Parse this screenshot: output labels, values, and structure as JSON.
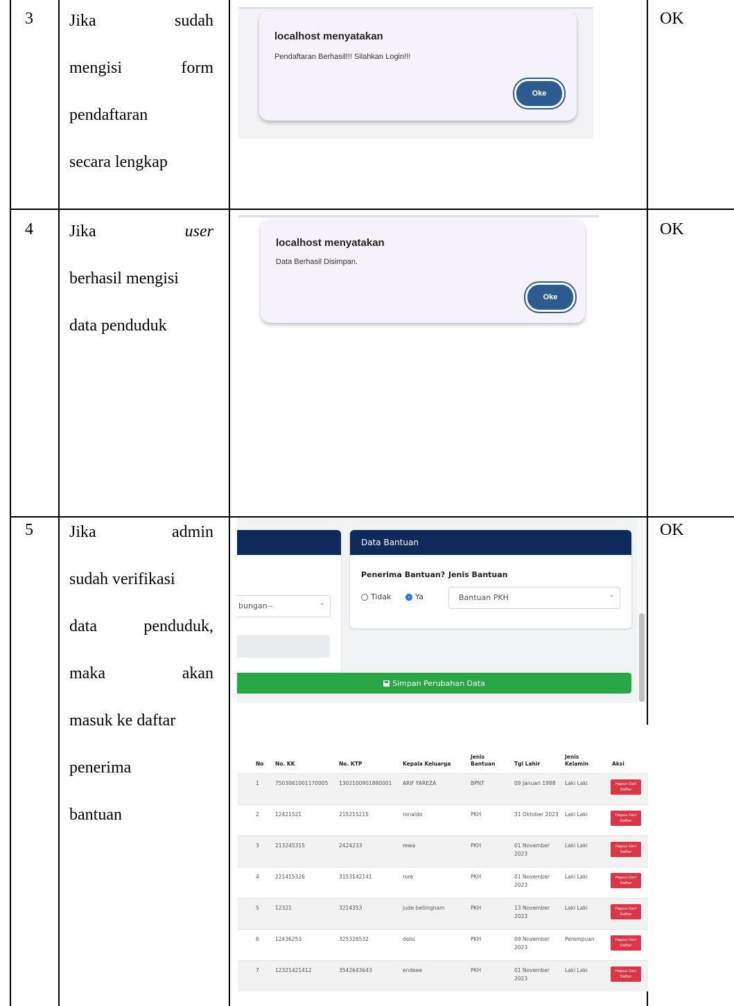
{
  "rows": [
    {
      "no": "3",
      "desc_lines": [
        [
          "Jika",
          "sudah"
        ],
        [
          "mengisi",
          "form"
        ],
        [
          "pendaftaran"
        ],
        [
          "secara lengkap"
        ]
      ],
      "status": "OK",
      "dialog": {
        "title": "localhost menyatakan",
        "message": "Pendaftaran Berhasil!!! Silahkan Login!!!",
        "button": "Oke"
      }
    },
    {
      "no": "4",
      "desc_lines": [
        [
          "Jika",
          "user"
        ],
        [
          "berhasil mengisi"
        ],
        [
          "data penduduk"
        ]
      ],
      "status": "OK",
      "dialog": {
        "title": "localhost menyatakan",
        "message": "Data Berhasil Disimpan.",
        "button": "Oke"
      }
    },
    {
      "no": "5",
      "desc_lines": [
        [
          "Jika",
          "admin"
        ],
        [
          "sudah verifikasi"
        ],
        [
          "data",
          "penduduk,"
        ],
        [
          "maka",
          "akan"
        ],
        [
          "masuk ke daftar"
        ],
        [
          "penerima"
        ],
        [
          "bantuan"
        ]
      ],
      "status": "OK"
    }
  ],
  "form": {
    "panel_title": "Data Bantuan",
    "penerima_label": "Penerima Bantuan?",
    "jenis_label": "Jenis Bantuan",
    "radio_no": "Tidak",
    "radio_yes": "Ya",
    "radio_selected": "Ya",
    "jenis_value": "Bantuan PKH",
    "left_select_value": "bungan--",
    "save_button": "Simpan Perubahan Data"
  },
  "table": {
    "headers": [
      "No",
      "No. KK",
      "No. KTP",
      "Kepala Keluarga",
      "Jenis Bantuan",
      "Tgl Lahir",
      "Jenis Kelamin",
      "Aksi"
    ],
    "action_label": "Hapus Dari Daftar",
    "rows": [
      [
        "1",
        "7503061001170005",
        "1302100901880001",
        "ARIF FAREZA",
        "BPNT",
        "09 Januari 1988",
        "Laki Laki"
      ],
      [
        "2",
        "12421521",
        "215215215",
        "ronaldo",
        "PKH",
        "31 Oktober 2023",
        "Laki Laki"
      ],
      [
        "3",
        "213245315",
        "2424233",
        "rewa",
        "PKH",
        "01 November 2023",
        "Laki Laki"
      ],
      [
        "4",
        "221415326",
        "3153142141",
        "rore",
        "PKH",
        "01 November 2023",
        "Laki Laki"
      ],
      [
        "5",
        "12321",
        "3214353",
        "jude bellingham",
        "PKH",
        "13 November 2023",
        "Laki Laki"
      ],
      [
        "6",
        "12436253",
        "325326532",
        "delsi",
        "PKH",
        "09 November 2023",
        "Perempuan"
      ],
      [
        "7",
        "12321421412",
        "3542643643",
        "endeee",
        "PKH",
        "01 November 2023",
        "Laki Laki"
      ]
    ]
  }
}
